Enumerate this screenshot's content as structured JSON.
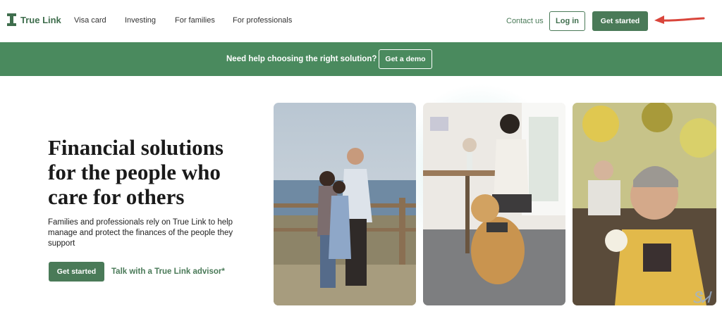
{
  "header": {
    "logo_text": "True Link",
    "nav": [
      "Visa card",
      "Investing",
      "For families",
      "For professionals"
    ],
    "contact": "Contact us",
    "login": "Log in",
    "get_started": "Get started"
  },
  "banner": {
    "text": "Need help choosing the right solution?",
    "demo": "Get a demo"
  },
  "hero": {
    "title_lines": [
      "Financial solutions",
      "for the people who",
      "care for others"
    ],
    "desc_lines": [
      "Families and professionals rely on True Link to help",
      "manage and protect the finances of the people they",
      "support"
    ],
    "get_started": "Get started",
    "advisor_link": "Talk with a True Link advisor*"
  },
  "photos": [
    "family-photo",
    "woman-with-dog-photo",
    "smiling-woman-photo"
  ],
  "colors": {
    "brand_green": "#4a7a58",
    "banner_green": "#4a8a5e",
    "arrow_red": "#d9453b"
  },
  "watermark": "ᏕᏗ"
}
